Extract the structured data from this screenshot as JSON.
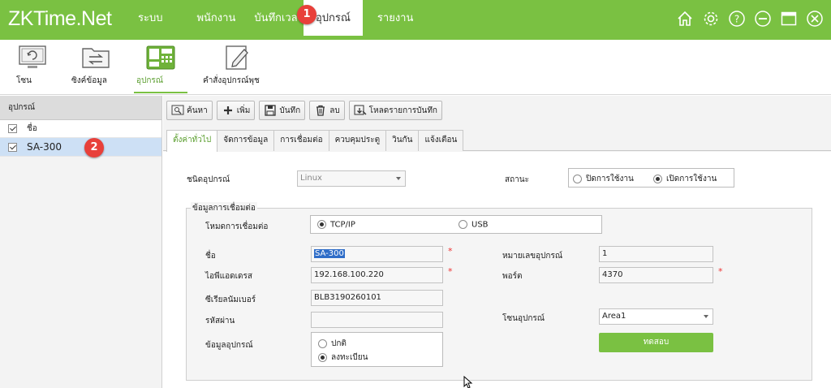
{
  "app": {
    "logo_main": "ZKTime",
    "logo_suffix": ".Net"
  },
  "menu": [
    {
      "label": "ระบบ"
    },
    {
      "label": "พนักงาน"
    },
    {
      "label": "บันทึกเวลา"
    },
    {
      "label": "อุปกรณ์",
      "active": true
    },
    {
      "label": "รายงาน"
    }
  ],
  "badges": [
    "1",
    "2"
  ],
  "window_icons": [
    "home-icon",
    "gear-icon",
    "help-icon",
    "minimize-icon",
    "maximize-icon",
    "close-icon"
  ],
  "toolbar": [
    {
      "label": "โซน",
      "icon": "zone-icon"
    },
    {
      "label": "ซิงค์ข้อมูล",
      "icon": "sync-folder-icon"
    },
    {
      "label": "อุปกรณ์",
      "icon": "device-icon",
      "active": true
    },
    {
      "label": "คำสั่งอุปกรณ์พุช",
      "icon": "edit-command-icon"
    }
  ],
  "left_panel": {
    "header": "อุปกรณ์",
    "rows": [
      {
        "label": "ชื่อ",
        "checked": true
      },
      {
        "label": "SA-300",
        "checked": true,
        "selected": true
      }
    ]
  },
  "actions": [
    {
      "label": "ค้นหา",
      "icon": "search-icon"
    },
    {
      "label": "เพิ่ม",
      "icon": "plus-icon"
    },
    {
      "label": "บันทึก",
      "icon": "save-icon"
    },
    {
      "label": "ลบ",
      "icon": "trash-icon"
    },
    {
      "label": "โหลดรายการบันทึก",
      "icon": "download-icon"
    }
  ],
  "tabs": [
    {
      "label": "ตั้งค่าทั่วไป",
      "active": true
    },
    {
      "label": "จัดการข้อมูล"
    },
    {
      "label": "การเชื่อมต่อ"
    },
    {
      "label": "ควบคุมประตู"
    },
    {
      "label": "วินกัน"
    },
    {
      "label": "แจ้งเตือน"
    }
  ],
  "form": {
    "device_type_label": "ชนิดอุปกรณ์",
    "device_type_value": "Linux",
    "status_label": "สถานะ",
    "status_options": [
      "ปิดการใช้งาน",
      "เปิดการใช้งาน"
    ],
    "status_selected": "เปิดการใช้งาน",
    "connection_legend": "ข้อมูลการเชื่อมต่อ",
    "conn_mode_label": "โหมดการเชื่อมต่อ",
    "conn_mode_options": [
      "TCP/IP",
      "USB"
    ],
    "conn_mode_selected": "TCP/IP",
    "name_label": "ชื่อ",
    "name_value": "SA-300",
    "device_number_label": "หมายเลขอุปกรณ์",
    "device_number_value": "1",
    "ip_label": "ไอพีแอดเดรส",
    "ip_value": "192.168.100.220",
    "port_label": "พอร์ต",
    "port_value": "4370",
    "serial_label": "ซีเรียลนัมเบอร์",
    "serial_value": "BLB3190260101",
    "password_label": "รหัสผ่าน",
    "password_value": "",
    "zone_label": "โซนอุปกรณ์",
    "zone_value": "Area1",
    "device_info_label": "ข้อมูลอุปกรณ์",
    "device_info_options": [
      "ปกติ",
      "ลงทะเบียน"
    ],
    "device_info_selected": "ลงทะเบียน",
    "required_mark": "*",
    "test_button": "ทดสอบ"
  },
  "colors": {
    "brand_green": "#7ac142",
    "badge_red": "#e8403a",
    "selection_blue": "#cde0f5"
  }
}
